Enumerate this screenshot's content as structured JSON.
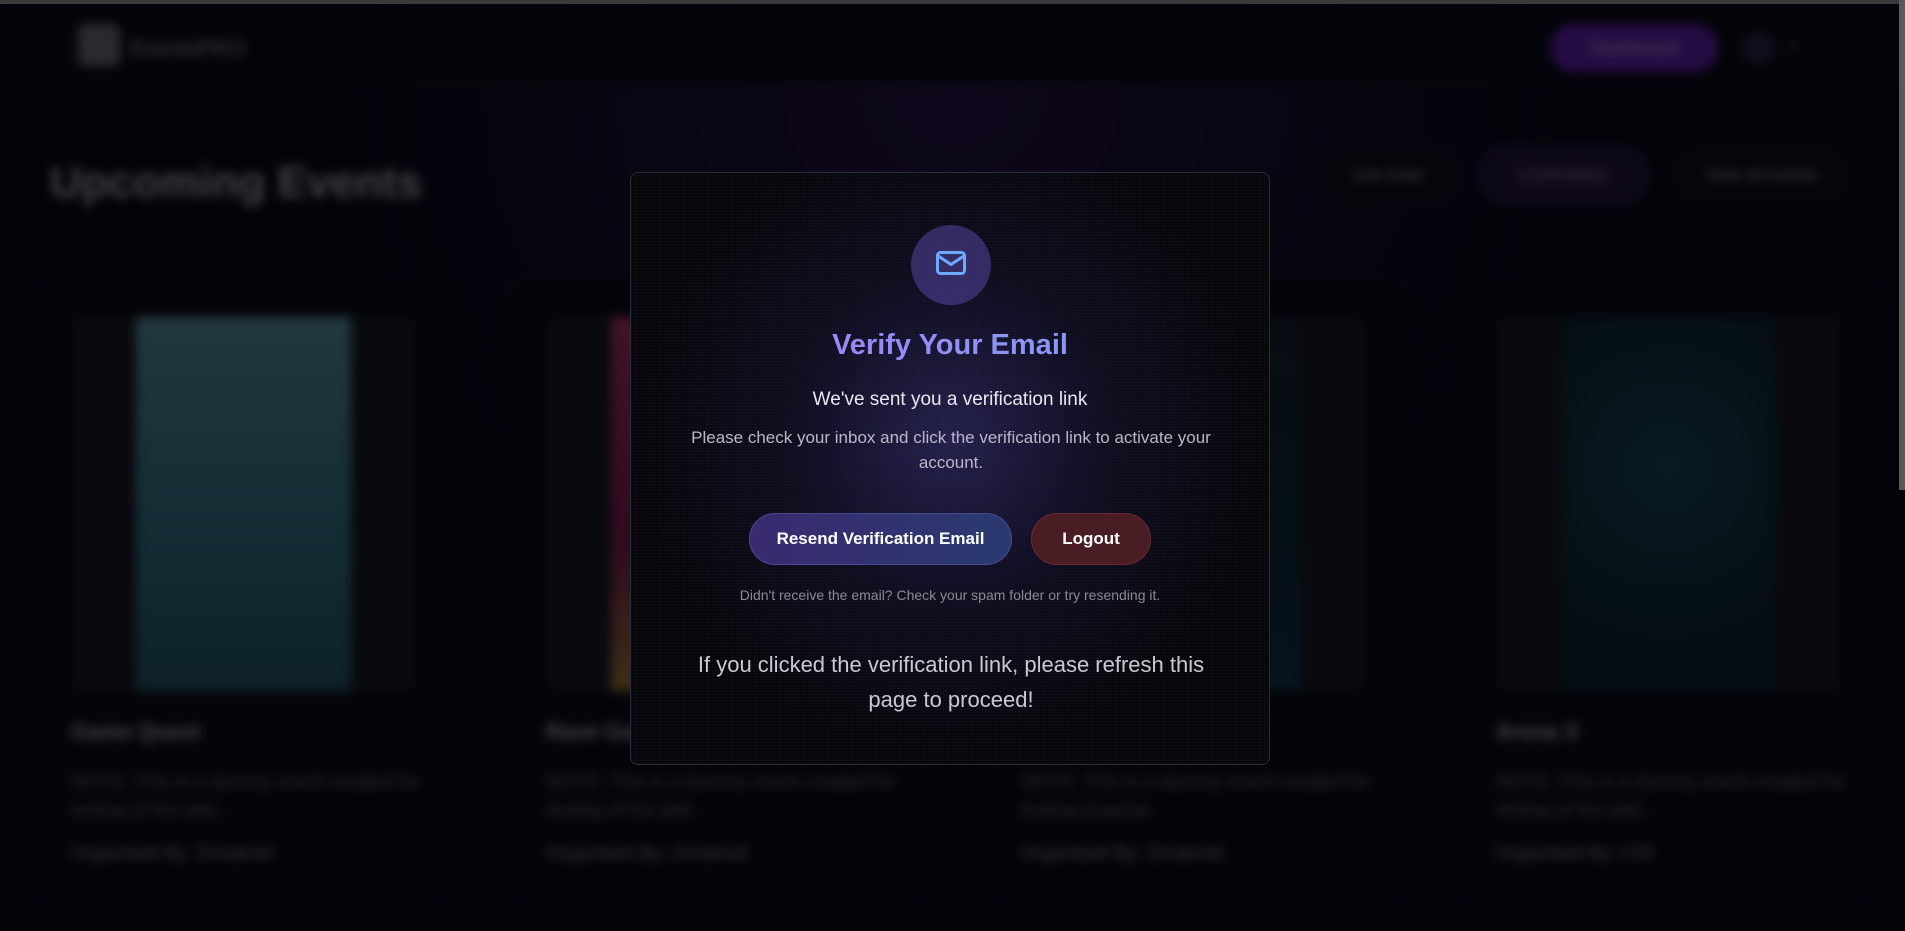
{
  "background": {
    "brand": "EventsPRO",
    "dashboard_label": "Dashboard",
    "heading": "Upcoming Events",
    "filters": [
      "Use Date",
      "Committees",
      "View all events"
    ],
    "events": [
      {
        "title": "Game Quest",
        "description": "NOTE: This is a dummy event created for testing of the plat...",
        "organizer": "Organised By: Zorakred"
      },
      {
        "title": "Rave Ga...",
        "description": "NOTE: This is a dummy event created for testing of the plat...",
        "organizer": "Organised By: Zorakred"
      },
      {
        "title": "",
        "description": "NOTE: This is a dummy event created for testing purpose",
        "organizer": "Organised By: Zorakred"
      },
      {
        "title": "Arena X",
        "description": "NOTE: This is a dummy event created for testing of the plat...",
        "organizer": "Organised By: CSI"
      }
    ]
  },
  "modal": {
    "icon": "mail-icon",
    "title": "Verify Your Email",
    "subtitle": "We've sent you a verification link",
    "body": "Please check your inbox and click the verification link to activate your account.",
    "resend_label": "Resend Verification Email",
    "logout_label": "Logout",
    "hint": "Didn't receive the email? Check your spam folder or try resending it.",
    "refresh_note": "If you clicked the verification link, please refresh this page to proceed!"
  },
  "colors": {
    "accent_purple": "#a57cf6",
    "accent_blue": "#7ea3f4",
    "logout_bg": "#4a1c24",
    "resend_bg": "#3a2a70"
  }
}
